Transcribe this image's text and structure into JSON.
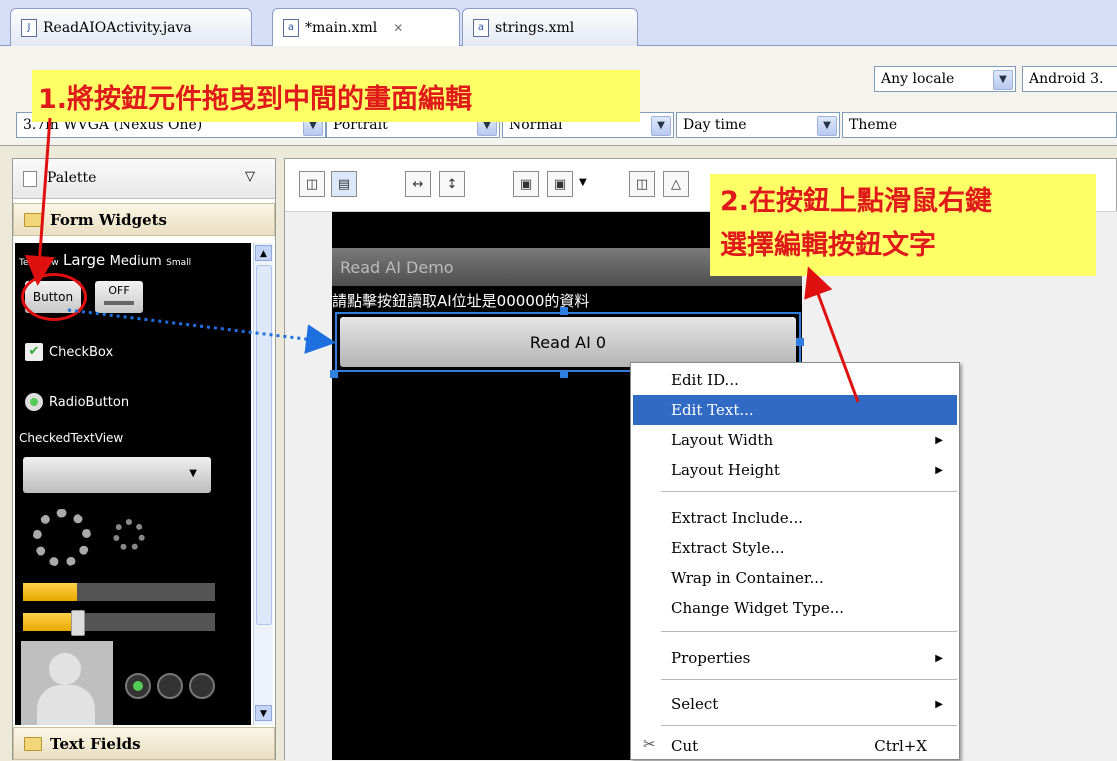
{
  "tabs": [
    {
      "label": "ReadAIOActivity.java",
      "icon": "java-file-icon"
    },
    {
      "label": "*main.xml",
      "icon": "xml-file-icon",
      "close": "✕"
    },
    {
      "label": "strings.xml",
      "icon": "xml-file-icon"
    }
  ],
  "config": {
    "locale": "Any locale",
    "target": "Android 3.",
    "device": "3.7in WVGA (Nexus One)",
    "orientation": "Portrait",
    "dock": "Normal",
    "night": "Day time",
    "theme": "Theme"
  },
  "palette": {
    "title": "Palette",
    "form_widgets": "Form Widgets",
    "text_fields": "Text Fields",
    "widgets": {
      "textview": "TextView",
      "large": "Large",
      "medium": "Medium",
      "small": "Small",
      "button": "Button",
      "toggle": "OFF",
      "checkbox": "CheckBox",
      "radiobutton": "RadioButton",
      "checkedtextview": "CheckedTextView"
    },
    "progress_level": 0.28,
    "seek_level": 0.28
  },
  "device_preview": {
    "app_title": "Read AI Demo",
    "prompt_text": "請點擊按鈕讀取AI位址是00000的資料",
    "button_text": "Read AI 0"
  },
  "context_menu": {
    "items": [
      {
        "label": "Edit ID...",
        "submenu": false,
        "selected": false
      },
      {
        "label": "Edit Text...",
        "submenu": false,
        "selected": true
      },
      {
        "label": "Layout Width",
        "submenu": true,
        "selected": false
      },
      {
        "label": "Layout Height",
        "submenu": true,
        "selected": false
      },
      {
        "label": "Extract Include...",
        "submenu": false,
        "selected": false
      },
      {
        "label": "Extract Style...",
        "submenu": false,
        "selected": false
      },
      {
        "label": "Wrap in Container...",
        "submenu": false,
        "selected": false
      },
      {
        "label": "Change Widget Type...",
        "submenu": false,
        "selected": false
      },
      {
        "label": "Properties",
        "submenu": true,
        "selected": false
      },
      {
        "label": "Select",
        "submenu": true,
        "selected": false
      },
      {
        "label": "Cut",
        "shortcut": "Ctrl+X",
        "submenu": false,
        "selected": false
      }
    ]
  },
  "annotations": {
    "step1": "1.將按鈕元件拖曳到中間的畫面編輯",
    "step2_line1": "2.在按鈕上點滑鼠右鍵",
    "step2_line2": "選擇編輯按鈕文字"
  },
  "colors": {
    "callout_bg": "#ffff66",
    "callout_text": "#e0191b",
    "menu_selected": "#316ac5",
    "arrow": "#e01010",
    "drag_line": "#1e6fe0"
  }
}
